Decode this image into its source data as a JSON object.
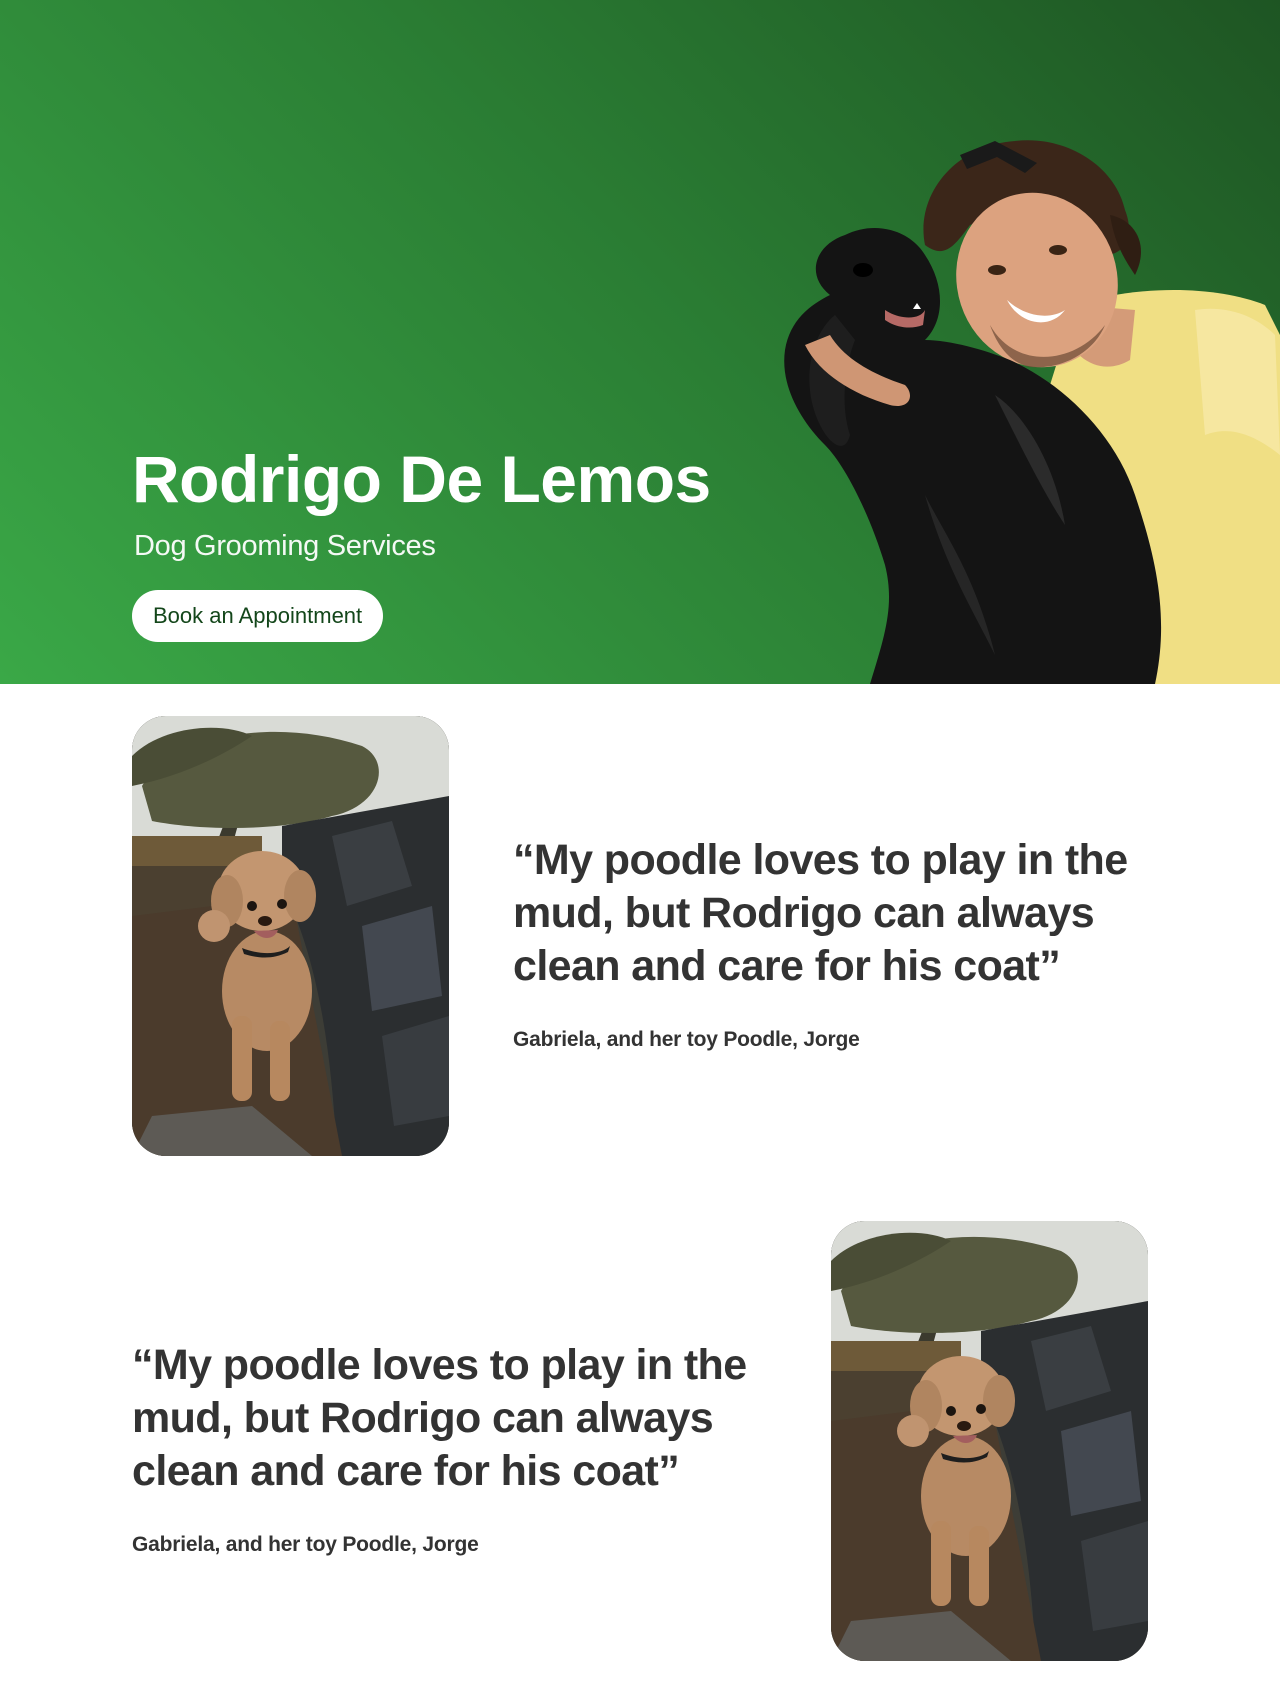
{
  "hero": {
    "title": "Rodrigo De Lemos",
    "subtitle": "Dog Grooming Services",
    "cta_label": "Book an Appointment",
    "photo": "photo-man-hugging-black-spaniel"
  },
  "testimonials": [
    {
      "quote": "“My poodle loves to play in the mud, but Rodrigo can always clean and care for his coat”",
      "author": "Gabriela, and her toy Poodle, Jorge",
      "photo": "photo-poodle-by-stone-wall"
    },
    {
      "quote": "“My poodle loves to play in the mud, but Rodrigo can always clean and care for his coat”",
      "author": "Gabriela, and her toy Poodle, Jorge",
      "photo": "photo-poodle-by-stone-wall"
    }
  ],
  "colors": {
    "hero_gradient_dark": "#1e5523",
    "hero_gradient_light": "#3aa847",
    "button_text": "#13461a",
    "body_text": "#333333"
  }
}
